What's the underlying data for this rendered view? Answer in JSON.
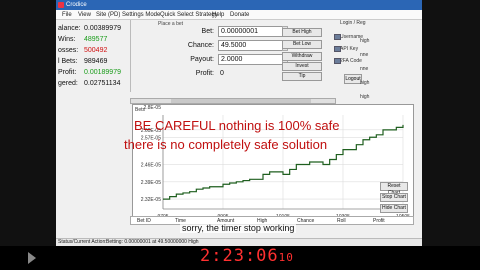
{
  "window": {
    "title": "Crodice"
  },
  "menu": [
    "File",
    "View",
    "Site (PD)",
    "Settings Mode",
    "Quick Select Strategy",
    "Help",
    "Donate"
  ],
  "stats": [
    {
      "label": "alance:",
      "value": "0.00389979",
      "color": "#111111"
    },
    {
      "label": "Wins:",
      "value": "489577",
      "color": "#1a9c1a"
    },
    {
      "label": "osses:",
      "value": "500492",
      "color": "#d01010"
    },
    {
      "label": "l Bets:",
      "value": "989469",
      "color": "#111111"
    },
    {
      "label": "Profit:",
      "value": "0.00189979",
      "color": "#1a9c1a"
    },
    {
      "label": "gered:",
      "value": "0.02751134",
      "color": "#111111"
    }
  ],
  "place_bet_label": "Place a bet",
  "bet_fields": {
    "bet": {
      "label": "Bet:",
      "value": "0.00000001"
    },
    "chance": {
      "label": "Chance:",
      "value": "49.5000"
    },
    "payout": {
      "label": "Payout:",
      "value": "2.0000"
    },
    "profit": {
      "label": "Profit:",
      "value": "0"
    }
  },
  "bet_buttons": [
    "Bet High",
    "Bet Low",
    "Withdraw",
    "Invest",
    "Tip"
  ],
  "right_panel": {
    "header": "Login / Reg",
    "items": [
      "Username",
      "API Key",
      "2FA Code"
    ],
    "logout": "Logout",
    "high_labels": [
      "high",
      "nne",
      "nne",
      "high",
      "high",
      "high",
      "high",
      "nne",
      "nne",
      "nne",
      "high"
    ]
  },
  "chart_data": {
    "type": "line",
    "title": "",
    "ylabel": "",
    "y_ticks": [
      "2.60E-05",
      "2.57E-05",
      "2.46E-05",
      "2.39E-05",
      "2.32E-05"
    ],
    "x_ticks": [
      "9705",
      "9905",
      "10105",
      "10305",
      "10505"
    ],
    "top_label": "Bets",
    "top_tick": "2.8E-05",
    "series": [
      {
        "values": [
          2.32,
          2.33,
          2.34,
          2.345,
          2.35,
          2.36,
          2.365,
          2.37,
          2.37,
          2.38,
          2.385,
          2.39,
          2.395,
          2.4,
          2.4,
          2.42,
          2.43,
          2.43,
          2.42,
          2.44,
          2.46,
          2.46,
          2.47,
          2.47,
          2.46,
          2.48,
          2.5,
          2.52,
          2.52,
          2.54,
          2.56,
          2.57,
          2.58,
          2.6,
          2.6,
          2.61,
          2.62
        ]
      }
    ],
    "ylim": [
      2.28,
      2.66
    ],
    "xlim": [
      9700,
      10560
    ]
  },
  "chart_buttons": [
    "Reset Chart",
    "Stop Chart",
    "Hide Chart"
  ],
  "grid_columns": [
    "Bet ID",
    "Time",
    "Amount",
    "High",
    "Chance",
    "Roll",
    "Profit"
  ],
  "status": {
    "label": "Status/Current Action:",
    "text": "Betting: 0.00000001 at 49.50000000 High"
  },
  "overlay": {
    "line1": "BE CAREFUL nothing is 100% safe",
    "line2": "there is no completely safe solution",
    "subtitle": "sorry, the timer stop working"
  },
  "clock": {
    "main": "2:23:06",
    "sub": "10"
  },
  "colors": {
    "caution": "#c01010",
    "clock": "#ff3030",
    "titlebar": "#2b66b5"
  }
}
